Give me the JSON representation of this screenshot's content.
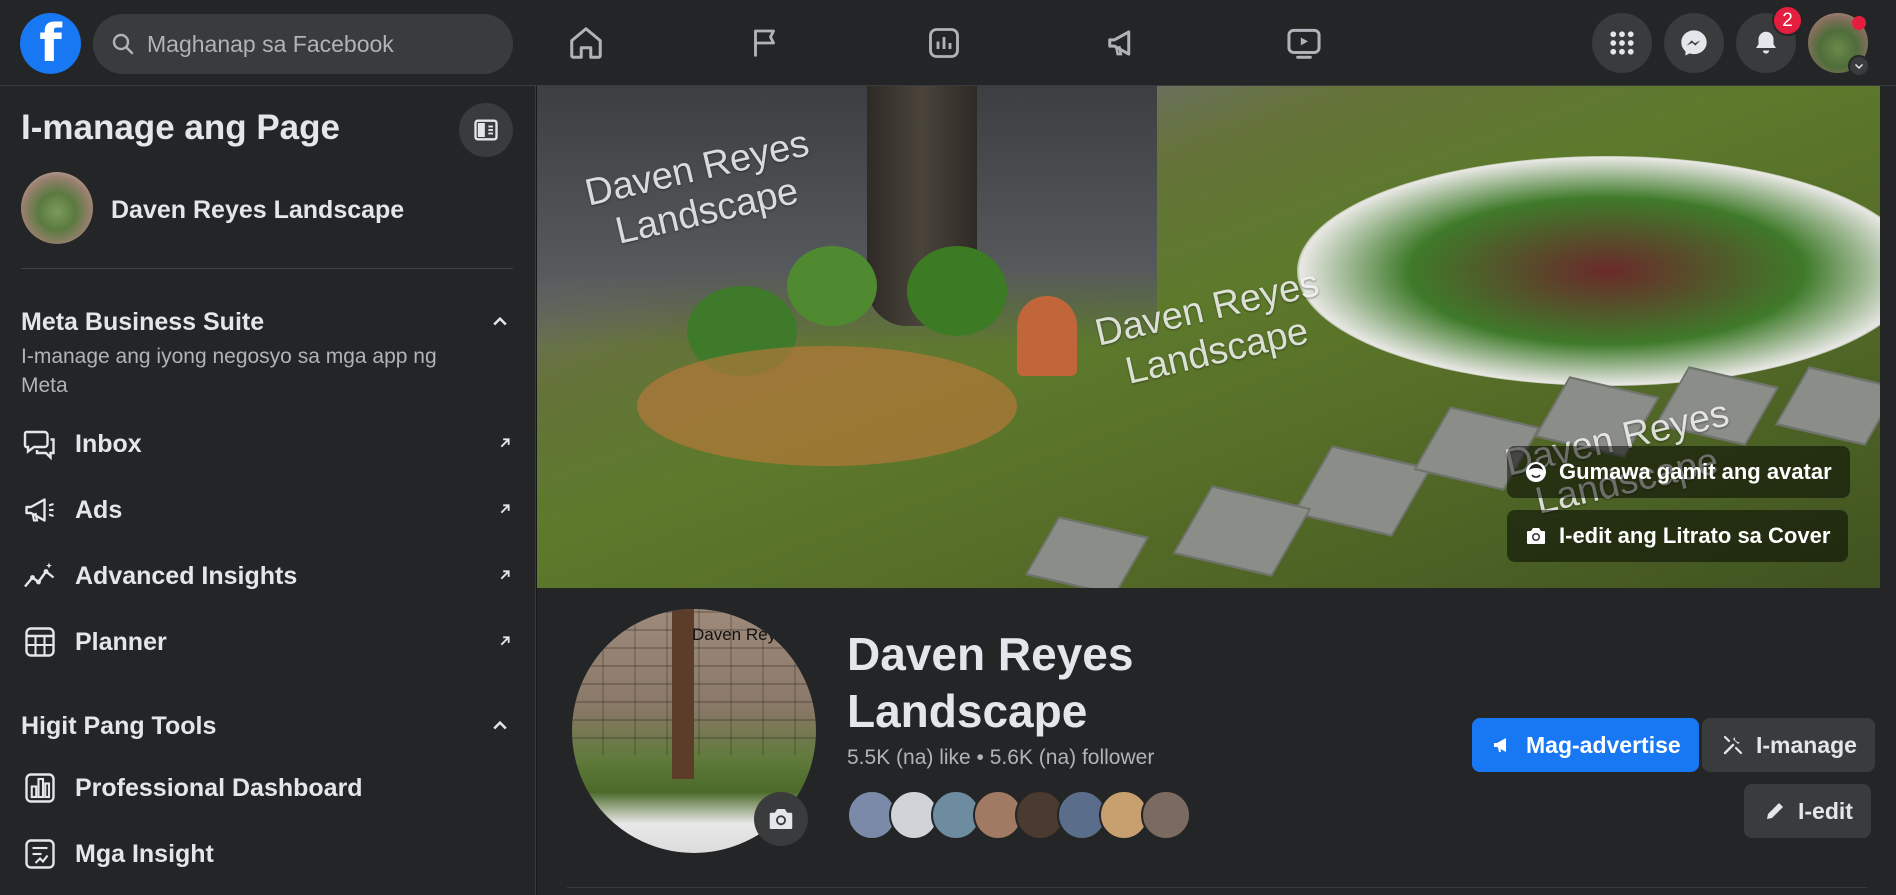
{
  "topbar": {
    "search_placeholder": "Maghanap sa Facebook",
    "notification_count": "2",
    "nav_icons": [
      "home-icon",
      "flag-icon",
      "insights-icon",
      "megaphone-icon",
      "video-icon"
    ],
    "right_icons": [
      "menu-grid-icon",
      "messenger-icon",
      "bell-icon"
    ]
  },
  "sidebar": {
    "title": "I-manage ang Page",
    "page_name": "Daven Reyes Landscape",
    "meta_section": {
      "title": "Meta Business Suite",
      "description": "I-manage ang iyong negosyo sa mga app ng Meta",
      "items": [
        {
          "label": "Inbox",
          "icon": "inbox-icon"
        },
        {
          "label": "Ads",
          "icon": "megaphone-icon"
        },
        {
          "label": "Advanced Insights",
          "icon": "trend-icon"
        },
        {
          "label": "Planner",
          "icon": "calendar-icon"
        }
      ]
    },
    "tools_section": {
      "title": "Higit Pang Tools",
      "items": [
        {
          "label": "Professional Dashboard",
          "icon": "dashboard-icon"
        },
        {
          "label": "Mga Insight",
          "icon": "insight-icon"
        }
      ]
    }
  },
  "cover": {
    "watermarks": [
      "Daven Reyes\nLandscape",
      "Daven Reyes\nLandscape",
      "Daven Reyes\nLandscape"
    ],
    "avatar_button": "Gumawa gamit ang avatar",
    "edit_cover_button": "I-edit ang Litrato sa Cover"
  },
  "profile": {
    "picture_watermark": "Daven Reye",
    "name_line1": "Daven Reyes",
    "name_line2": "Landscape",
    "stats": "5.5K (na) like • 5.6K (na) follower",
    "buttons": {
      "advertise": "Mag-advertise",
      "manage": "I-manage",
      "edit": "I-edit"
    }
  },
  "colors": {
    "accent": "#1877f2",
    "badge": "#e41e3f",
    "surface": "#242526",
    "button_bg": "#3a3b3c"
  }
}
